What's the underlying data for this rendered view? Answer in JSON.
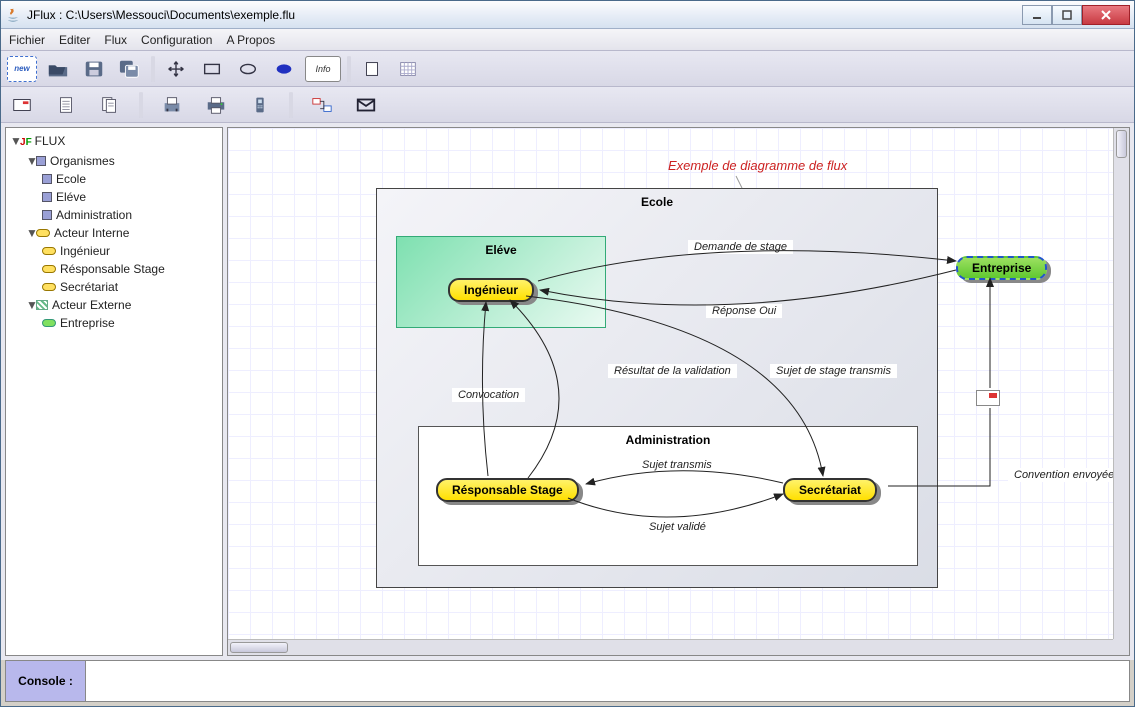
{
  "window": {
    "title": "JFlux : C:\\Users\\Messouci\\Documents\\exemple.flu"
  },
  "menu": {
    "items": [
      "Fichier",
      "Editer",
      "Flux",
      "Configuration",
      "A Propos"
    ]
  },
  "toolbar1": {
    "new": "new",
    "info": "Info"
  },
  "tree": {
    "root": "FLUX",
    "organismes": {
      "label": "Organismes",
      "items": [
        "Ecole",
        "Eléve",
        "Administration"
      ]
    },
    "acteur_interne": {
      "label": "Acteur Interne",
      "items": [
        "Ingénieur",
        "Résponsable Stage",
        "Secrétariat"
      ]
    },
    "acteur_externe": {
      "label": "Acteur Externe",
      "items": [
        "Entreprise"
      ]
    }
  },
  "diagram": {
    "title": "Exemple de diagramme de flux",
    "ecole": "Ecole",
    "eleve": "Eléve",
    "administration": "Administration",
    "actors": {
      "ingenieur": "Ingénieur",
      "entreprise": "Entreprise",
      "responsable": "Résponsable Stage",
      "secretariat": "Secrétariat"
    },
    "flows": {
      "demande": "Demande de stage",
      "reponse": "Réponse Oui",
      "resultat": "Résultat de la\nvalidation",
      "sujet_transmis_ext": "Sujet de stage\ntransmis",
      "convocation": "Convocation",
      "sujet_transmis": "Sujet transmis",
      "sujet_valide": "Sujet validé",
      "convention": "Convention\nenvoyée"
    }
  },
  "console": {
    "label": "Console :"
  }
}
